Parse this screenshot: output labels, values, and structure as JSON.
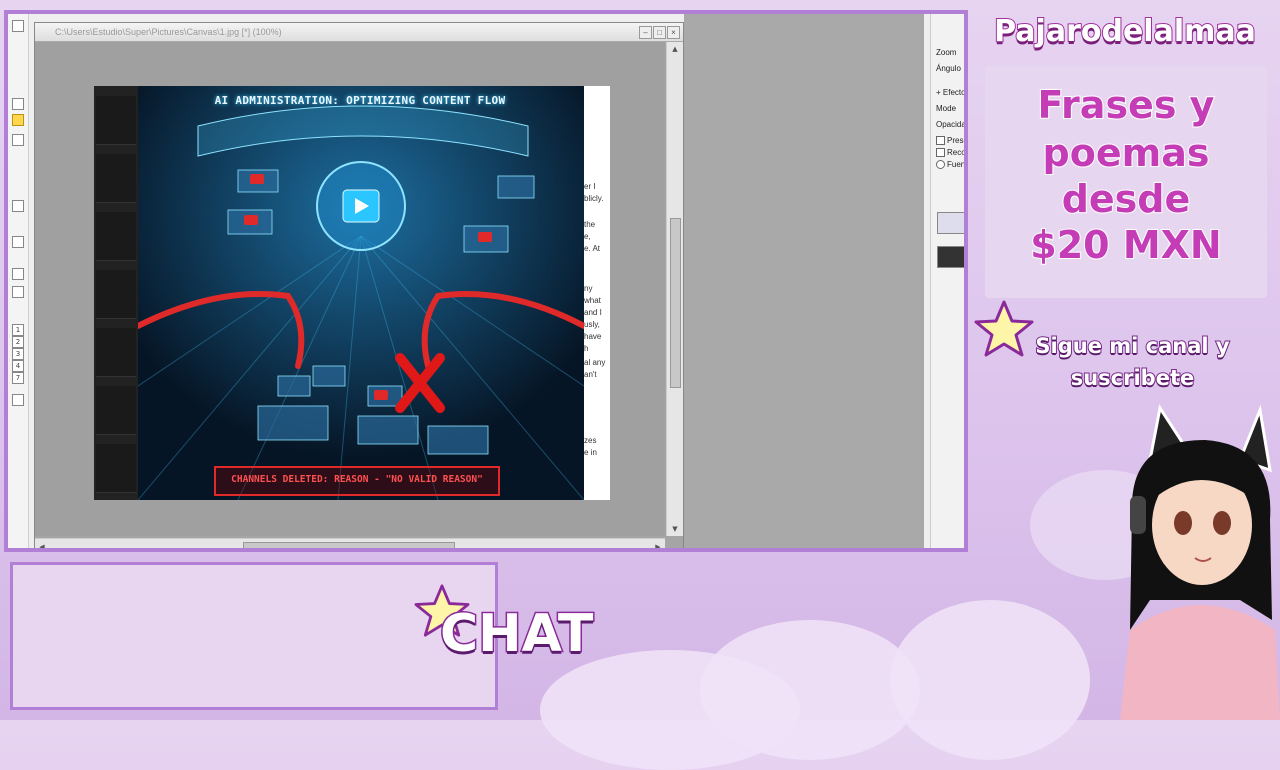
{
  "overlay": {
    "channel_name": "Pajarodelalmaa",
    "promo_lines": [
      "Frases y",
      "poemas",
      "desde",
      "$20 MXN"
    ],
    "subscribe_lines": [
      "Sigue mi canal y",
      "suscribete"
    ],
    "chat_label": "CHAT",
    "accent_color": "#b27fd6",
    "promo_color": "#c43db6"
  },
  "editor": {
    "document_title": "C:\\Users\\Estudio\\Super\\Pictures\\Canvas\\1.jpg [*] (100%)",
    "right_panel": {
      "zoom_label": "Zoom",
      "angle_label": "Ángulo",
      "effects_label": "Efecto",
      "mode_label": "Mode",
      "opacity_label": "Opacidad",
      "options": [
        "Preser",
        "Recort",
        "Fuente"
      ]
    },
    "left_tools": [
      "1",
      "2",
      "3",
      "4",
      "7"
    ]
  },
  "artwork": {
    "heading": "AI ADMINISTRATION: OPTIMIZING CONTENT FLOW",
    "banner": "CHANNELS DELETED: REASON - \"NO VALID REASON\"",
    "side_text": [
      "er I",
      "blicly.",
      "the",
      "e,",
      "e. At",
      "ny",
      "what",
      "and I",
      "usly,",
      "have",
      "h",
      "al any",
      "an't",
      "zes",
      "e in"
    ]
  }
}
